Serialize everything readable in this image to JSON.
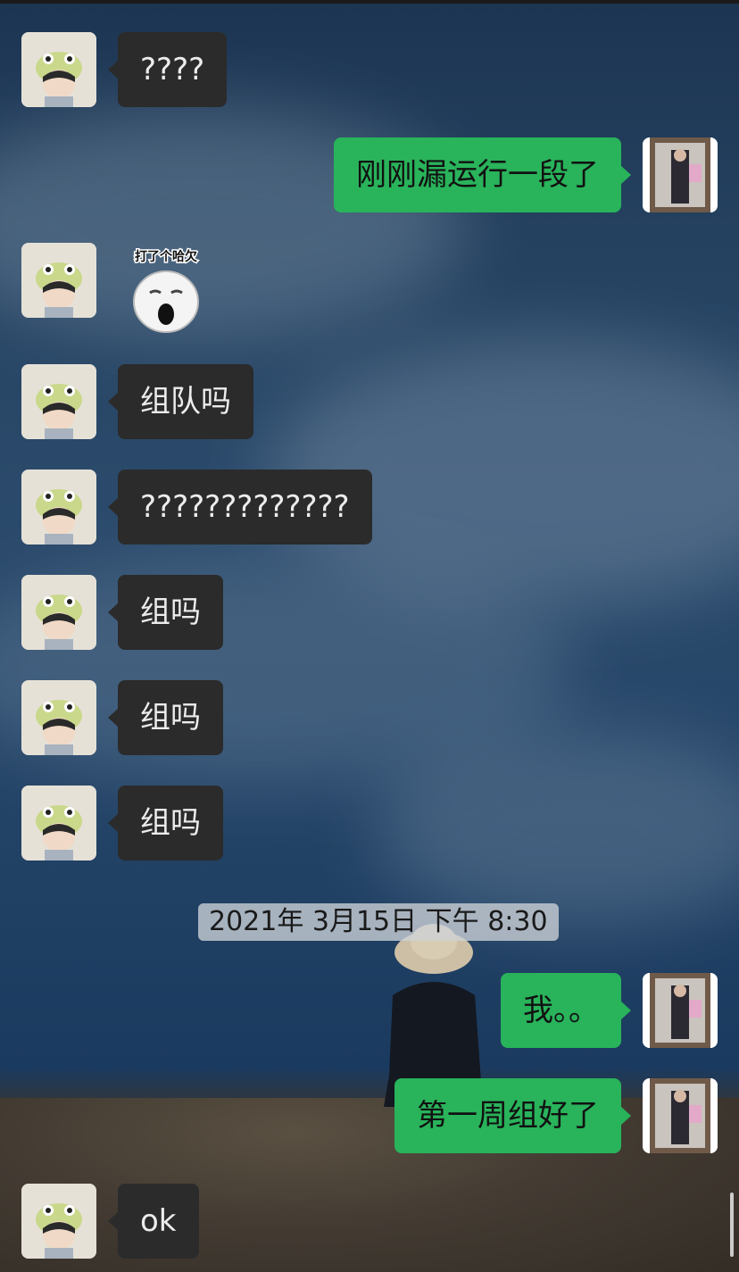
{
  "chat": {
    "messages": [
      {
        "sender": "friend",
        "text": "????"
      },
      {
        "sender": "me",
        "text": "刚刚漏运行一段了"
      },
      {
        "sender": "friend",
        "sticker": "打了个哈欠"
      },
      {
        "sender": "friend",
        "text": "组队吗"
      },
      {
        "sender": "friend",
        "text": "?????????????"
      },
      {
        "sender": "friend",
        "text": "组吗"
      },
      {
        "sender": "friend",
        "text": "组吗"
      },
      {
        "sender": "friend",
        "text": "组吗"
      },
      {
        "sender": "me",
        "text": "我。。"
      },
      {
        "sender": "me",
        "text": "第一周组好了"
      },
      {
        "sender": "friend",
        "text": "ok"
      }
    ],
    "timestamp": "2021年 3月15日 下午 8:30"
  },
  "colors": {
    "friend_bubble": "#2b2b2b",
    "me_bubble": "#29b35b",
    "timestamp_bg": "#cdd2d7"
  },
  "icons": {
    "friend_avatar": "child-with-alien-hat-avatar",
    "me_avatar": "person-photo-avatar",
    "sticker": "yawning-face-sticker"
  }
}
